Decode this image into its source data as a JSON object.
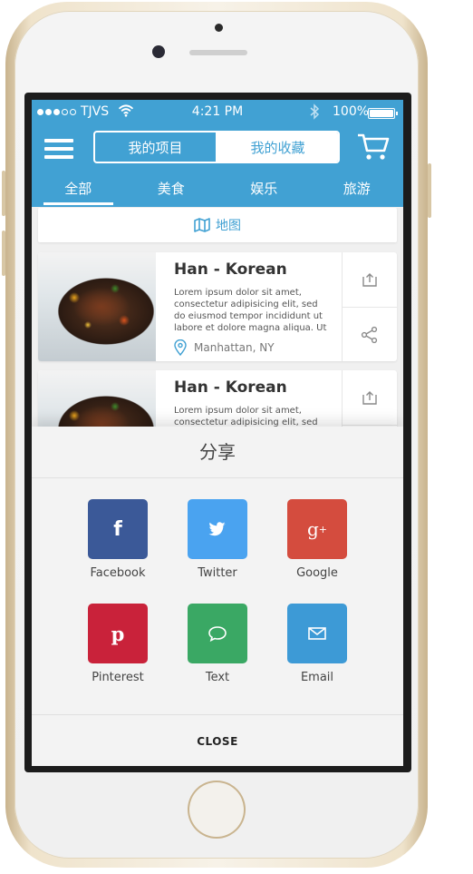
{
  "status_bar": {
    "carrier": "TJVS",
    "time": "4:21 PM",
    "battery": "100%"
  },
  "header": {
    "tab_left": "我的项目",
    "tab_right": "我的收藏",
    "categories": [
      {
        "label": "全部",
        "active": true
      },
      {
        "label": "美食",
        "active": false
      },
      {
        "label": "娱乐",
        "active": false
      },
      {
        "label": "旅游",
        "active": false
      }
    ]
  },
  "map_button": {
    "label": "地图"
  },
  "cards": [
    {
      "title": "Han - Korean",
      "description": "Lorem ipsum dolor sit amet, consectetur adipisicing elit, sed do eiusmod tempor incididunt ut labore et dolore magna aliqua. Ut",
      "location": "Manhattan, NY"
    },
    {
      "title": "Han - Korean",
      "description": "Lorem ipsum dolor sit amet, consectetur adipisicing elit, sed do"
    }
  ],
  "share_sheet": {
    "title": "分享",
    "items": [
      {
        "label": "Facebook",
        "icon": "facebook-icon",
        "color": "#3b5998"
      },
      {
        "label": "Twitter",
        "icon": "twitter-icon",
        "color": "#4aa3f0"
      },
      {
        "label": "Google",
        "icon": "google-plus-icon",
        "color": "#d44c3e"
      },
      {
        "label": "Pinterest",
        "icon": "pinterest-icon",
        "color": "#c9223a"
      },
      {
        "label": "Text",
        "icon": "chat-bubble-icon",
        "color": "#3aa864"
      },
      {
        "label": "Email",
        "icon": "envelope-icon",
        "color": "#3d9ad6"
      }
    ],
    "close_label": "CLOSE"
  },
  "colors": {
    "accent": "#41a1d3",
    "background": "#f0f0f0"
  }
}
